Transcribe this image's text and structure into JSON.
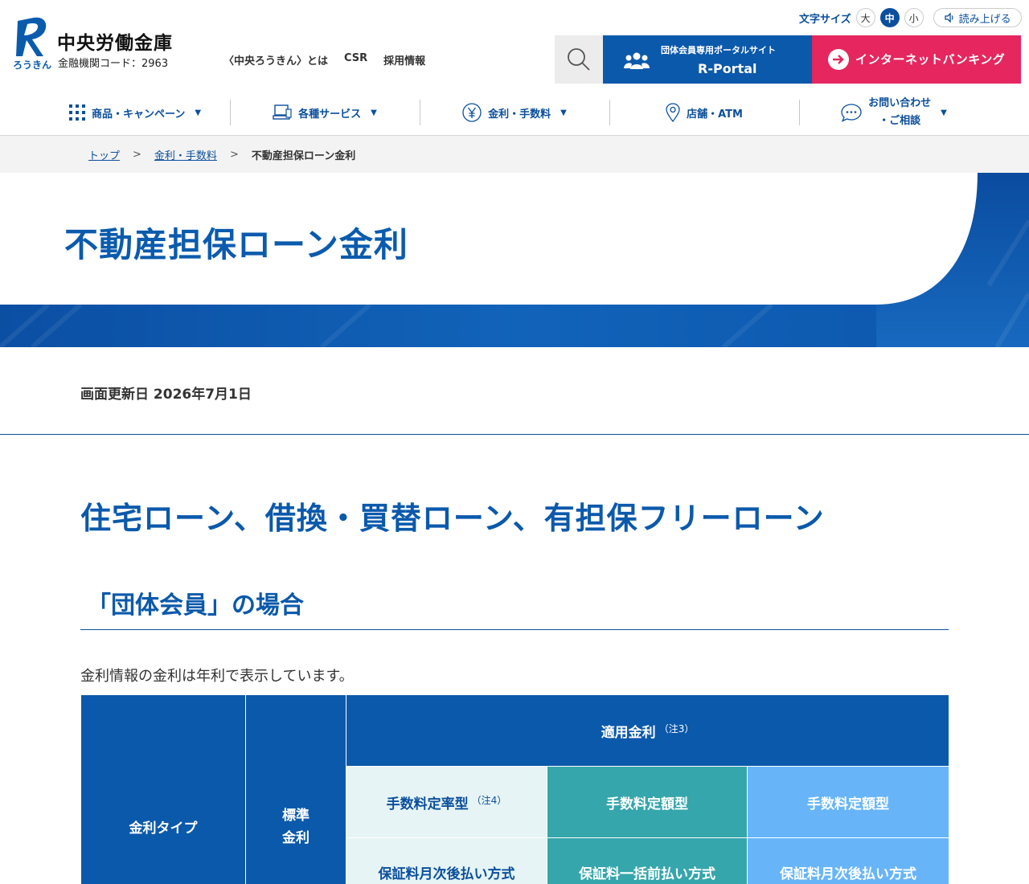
{
  "header": {
    "logo_name": "中央労働金庫",
    "logo_code": "金融機関コード：2963",
    "logo_hira": "ろうきん",
    "links": [
      "〈中央ろうきん〉とは",
      "CSR",
      "採用情報"
    ],
    "font_size_label": "文字サイズ",
    "font_sizes": [
      "大",
      "中",
      "小"
    ],
    "read_aloud": "読み上げる",
    "portal_sub": "団体会員専用ポータルサイト",
    "portal_main": "R-Portal",
    "internet_banking": "インターネットバンキング"
  },
  "gnav": {
    "items": [
      {
        "label": "商品・キャンペーン",
        "icon": "grid-icon"
      },
      {
        "label": "各種サービス",
        "icon": "computer-icon"
      },
      {
        "label": "金利・手数料",
        "icon": "yen-icon"
      },
      {
        "label": "店舗・ATM",
        "icon": "map-pin-icon"
      },
      {
        "label_line1": "お問い合わせ",
        "label_line2": "・ご相談",
        "icon": "chat-icon"
      }
    ]
  },
  "breadcrumb": {
    "top": "トップ",
    "rates": "金利・手数料",
    "current": "不動産担保ローン金利",
    "sep": ">"
  },
  "hero": {
    "title": "不動産担保ローン金利"
  },
  "content": {
    "updated": "画面更新日 2026年7月1日",
    "h2": "住宅ローン、借換・買替ローン、有担保フリーローン",
    "h3": "「団体会員」の場合",
    "note": "金利情報の金利は年利で表示しています。"
  },
  "table": {
    "col_type": "金利タイプ",
    "col_standard_line1": "標準",
    "col_standard_line2": "金利",
    "applied": "適用金利",
    "applied_note": "（注3）",
    "fee_fixed_rate": "手数料定率型",
    "fee_fixed_rate_note": "（注4）",
    "fee_fixed_amount_1": "手数料定額型",
    "fee_fixed_amount_2": "手数料定額型",
    "method_1": "保証料月次後払い方式",
    "method_2": "保証料一括前払い方式",
    "method_3": "保証料月次後払い方式"
  },
  "colors": {
    "brand_blue": "#0b59ab",
    "accent_pink": "#e5265f",
    "teal": "#35a6ab",
    "sky": "#67b5f8",
    "pale": "#e6f4f5"
  }
}
